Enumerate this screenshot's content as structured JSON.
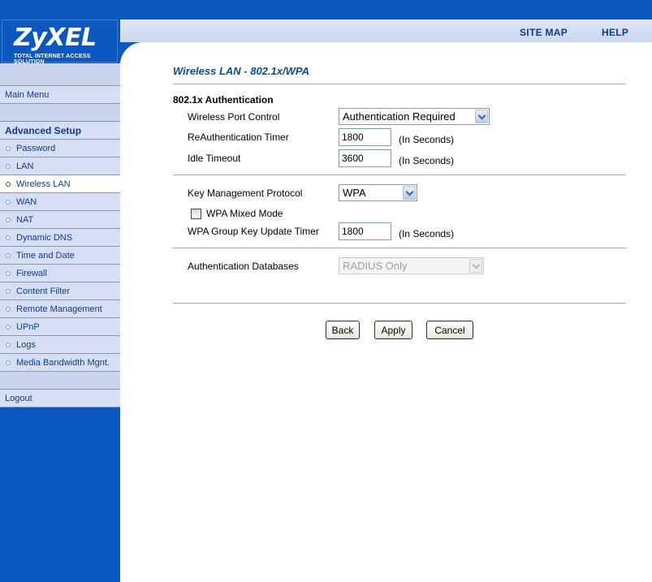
{
  "brand": {
    "logo_text": "ZyXEL",
    "tagline": "Total Internet Access Solution"
  },
  "header": {
    "site_map": "SITE MAP",
    "help": "HELP"
  },
  "sidebar": {
    "main_menu": "Main Menu",
    "advanced_setup": "Advanced Setup",
    "items": [
      "Password",
      "LAN",
      "Wireless LAN",
      "WAN",
      "NAT",
      "Dynamic DNS",
      "Time and Date",
      "Firewall",
      "Content Filter",
      "Remote Management",
      "UPnP",
      "Logs",
      "Media Bandwidth Mgnt."
    ],
    "active_item": "Wireless LAN",
    "logout": "Logout"
  },
  "page": {
    "title": "Wireless LAN - 802.1x/WPA",
    "section": "802.1x Authentication",
    "port_control": {
      "label": "Wireless Port Control",
      "value": "Authentication Required"
    },
    "reauth_timer": {
      "label": "ReAuthentication Timer",
      "value": "1800",
      "unit": "(In Seconds)"
    },
    "idle_timeout": {
      "label": "Idle Timeout",
      "value": "3600",
      "unit": "(In Seconds)"
    },
    "key_mgmt": {
      "label": "Key Management Protocol",
      "value": "WPA"
    },
    "wpa_mixed": {
      "label": "WPA Mixed Mode",
      "checked": false
    },
    "group_key_timer": {
      "label": "WPA Group Key Update Timer",
      "value": "1800",
      "unit": "(In Seconds)"
    },
    "auth_db": {
      "label": "Authentication Databases",
      "value": "RADIUS Only"
    }
  },
  "buttons": {
    "back": "Back",
    "apply": "Apply",
    "cancel": "Cancel"
  },
  "colors": {
    "brand_blue": "#0a58c0",
    "title_blue": "#0a4d8a",
    "menu_bg": "#d6def4"
  }
}
